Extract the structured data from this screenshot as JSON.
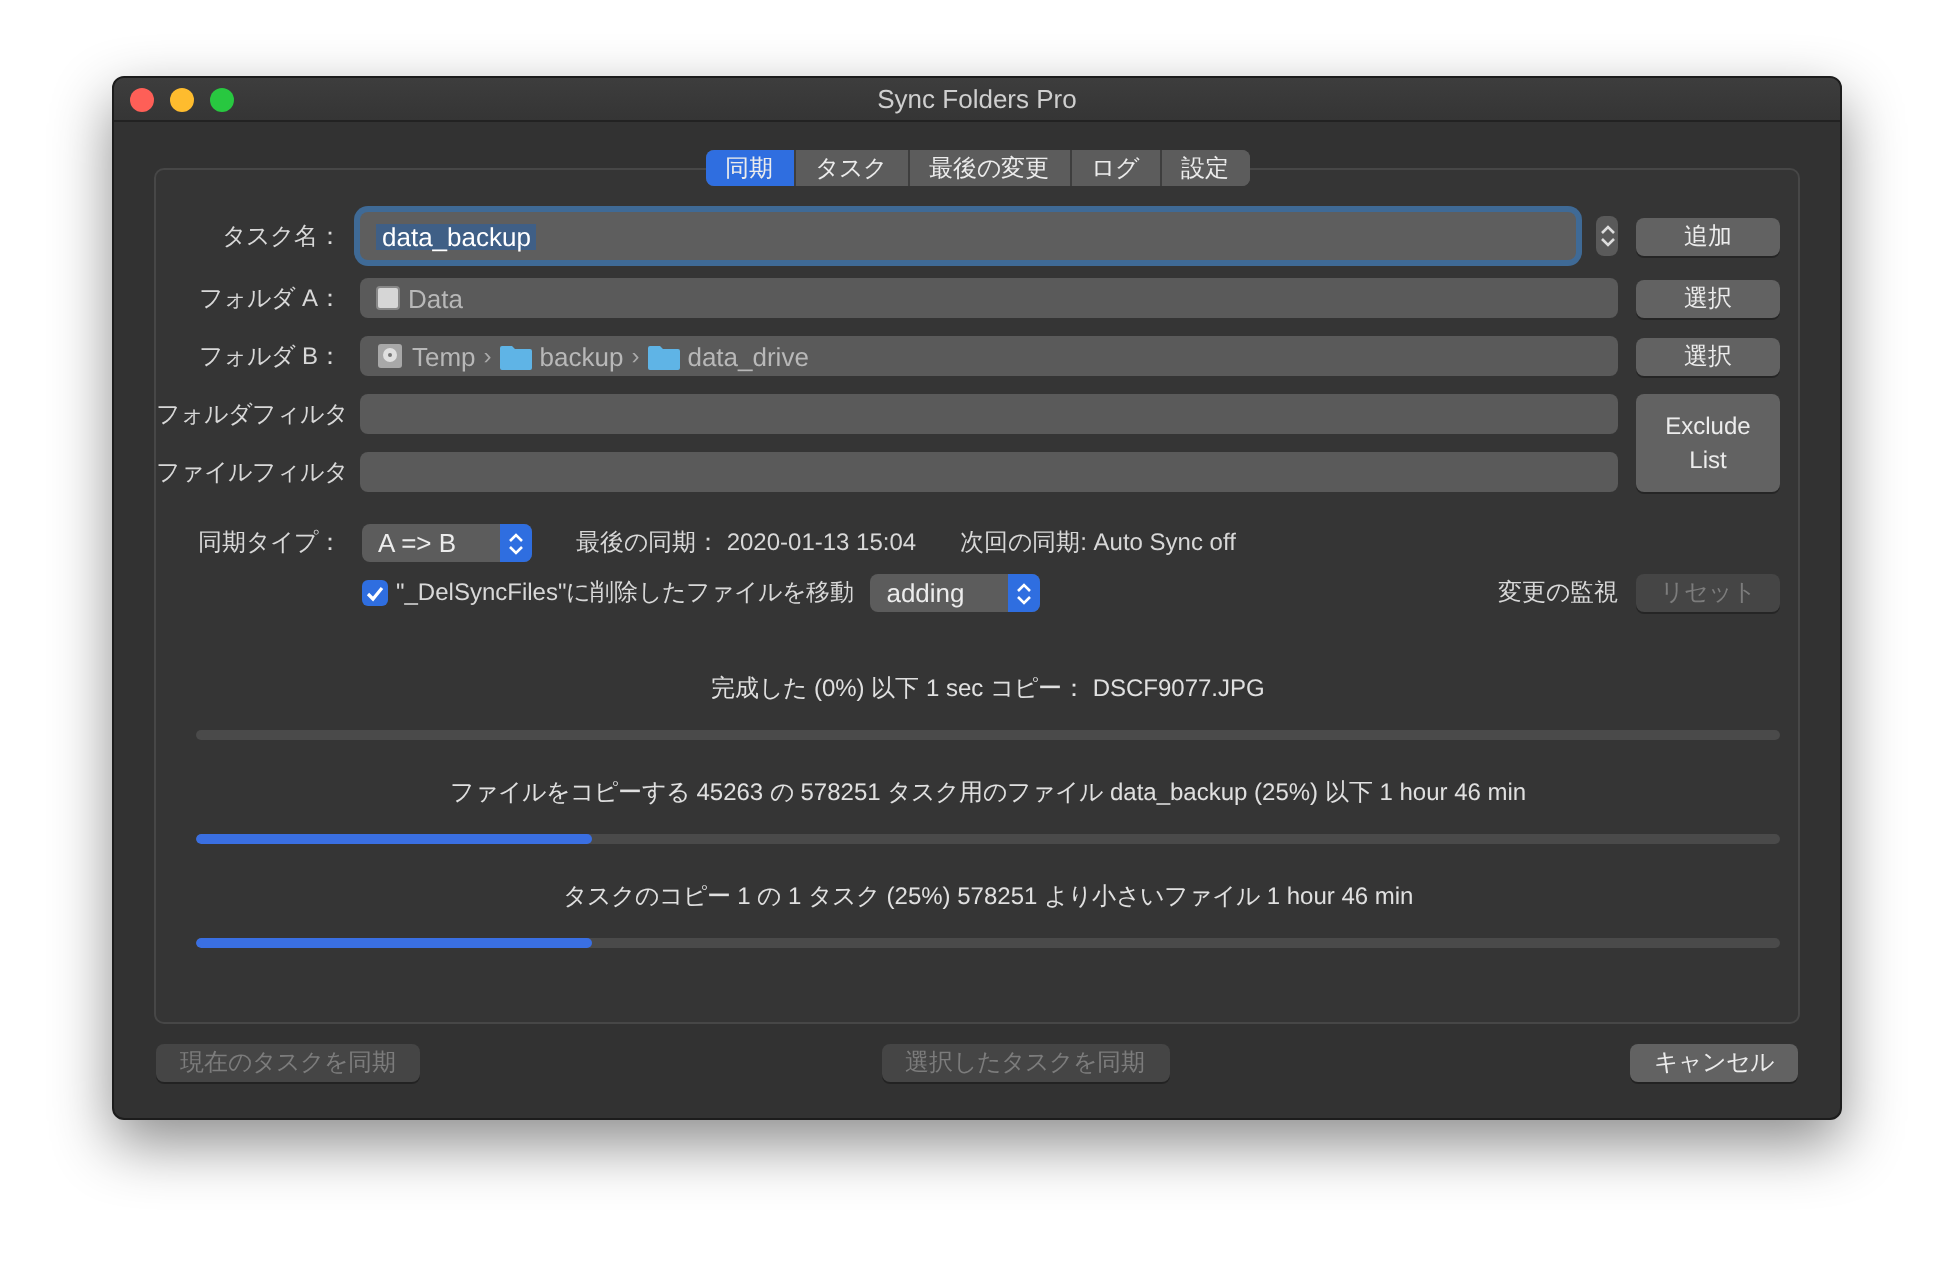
{
  "window": {
    "title": "Sync Folders Pro"
  },
  "tabs": [
    {
      "label": "同期",
      "selected": true
    },
    {
      "label": "タスク",
      "selected": false
    },
    {
      "label": "最後の変更",
      "selected": false
    },
    {
      "label": "ログ",
      "selected": false
    },
    {
      "label": "設定",
      "selected": false
    }
  ],
  "task_name": {
    "label": "タスク名：",
    "value": "data_backup",
    "focused": true,
    "text_selected": true,
    "button": "追加"
  },
  "folder_a": {
    "label": "フォルダ A：",
    "path": [
      {
        "kind": "drive",
        "name": "Data"
      }
    ],
    "button": "選択"
  },
  "folder_b": {
    "label": "フォルダ B：",
    "separator": "›",
    "path": [
      {
        "kind": "disk",
        "name": "Temp"
      },
      {
        "kind": "folder",
        "name": "backup"
      },
      {
        "kind": "folder",
        "name": "data_drive"
      }
    ],
    "button": "選択"
  },
  "folder_filter": {
    "label": "フォルダフィルタ"
  },
  "file_filter": {
    "label": "ファイルフィルタ"
  },
  "exclude_button": "Exclude List",
  "sync_type": {
    "label": "同期タイプ：",
    "value": "A => B"
  },
  "last_sync": "最後の同期： 2020-01-13 15:04",
  "next_sync": "次回の同期: Auto Sync off",
  "move_deleted": {
    "label": "\"_DelSyncFiles\"に削除したファイルを移動",
    "checked": true,
    "mode": "adding"
  },
  "monitor": {
    "label": "変更の監視",
    "button": "リセット",
    "disabled": true
  },
  "progress": [
    {
      "text": "完成した (0%) 以下 1 sec コピー： DSCF9077.JPG",
      "level": 0
    },
    {
      "text": "ファイルをコピーする 45263 の 578251 タスク用のファイル data_backup (25%) 以下 1 hour 46 min",
      "level": 0.25
    },
    {
      "text": "タスクのコピー 1 の 1 タスク (25%) 578251 より小さいファイル 1 hour 46 min",
      "level": 0.25
    }
  ],
  "footer": {
    "buttons": [
      {
        "label": "現在のタスクを同期",
        "disabled": true
      },
      {
        "label": "選択したタスクを同期",
        "disabled": true
      },
      {
        "label": "キャンセル",
        "disabled": false
      }
    ]
  }
}
